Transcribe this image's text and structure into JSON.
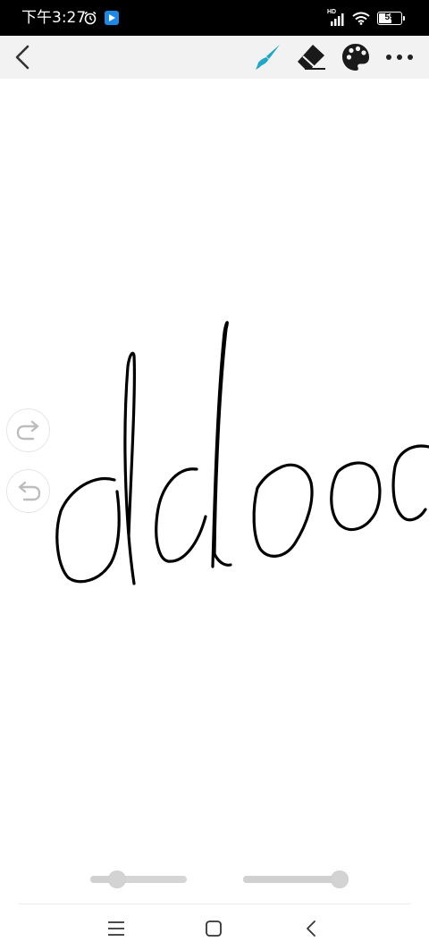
{
  "status_bar": {
    "time": "下午3:27",
    "network_label": "HD",
    "battery": {
      "percent": 59,
      "label": "59"
    }
  },
  "toolbar": {
    "back_icon": "chevron-left-icon",
    "tools": [
      {
        "name": "brush",
        "icon": "paintbrush-icon",
        "active": true,
        "color": "#1ea8c8"
      },
      {
        "name": "eraser",
        "icon": "eraser-icon",
        "active": false
      },
      {
        "name": "palette",
        "icon": "palette-icon",
        "active": false
      },
      {
        "name": "more",
        "icon": "more-icon",
        "active": false
      }
    ]
  },
  "canvas": {
    "ink_color": "#000000",
    "side_controls": [
      {
        "name": "redo",
        "icon": "redo-icon"
      },
      {
        "name": "undo",
        "icon": "undo-icon"
      }
    ]
  },
  "sliders": {
    "stroke_size": {
      "value": 0.28
    },
    "opacity": {
      "value": 1.0
    }
  },
  "nav_bar": {
    "icons": [
      "menu-icon",
      "home-icon",
      "back-icon"
    ]
  }
}
